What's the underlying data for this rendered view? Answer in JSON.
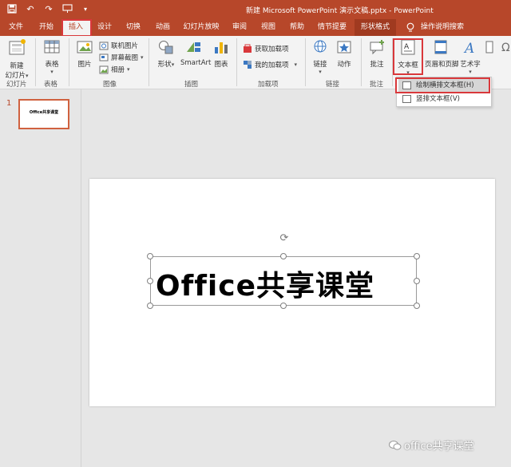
{
  "title_bar": {
    "document_title": "新建 Microsoft PowerPoint 演示文稿.pptx  -  PowerPoint",
    "qat": [
      "save-icon",
      "undo-icon",
      "redo-icon",
      "presenter-icon",
      "customize-icon"
    ]
  },
  "tabs": [
    "文件",
    "开始",
    "插入",
    "设计",
    "切换",
    "动画",
    "幻灯片放映",
    "审阅",
    "视图",
    "帮助",
    "情节提要",
    "形状格式",
    "操作说明搜索"
  ],
  "active_tab": "插入",
  "ribbon": {
    "slides": {
      "new_slide": "新建",
      "new_slide2": "幻灯片",
      "group": "幻灯片"
    },
    "tables": {
      "table": "表格",
      "group": "表格"
    },
    "images": {
      "picture": "图片",
      "online_picture": "联机图片",
      "screenshot": "屏幕截图",
      "album": "相册",
      "group": "图像"
    },
    "illustrations": {
      "shapes": "形状",
      "smartart": "SmartArt",
      "chart": "图表",
      "group": "插图"
    },
    "addins": {
      "get_addins": "获取加载项",
      "my_addins": "我的加载项",
      "group": "加载项"
    },
    "links": {
      "link": "链接",
      "action": "动作",
      "group": "链接"
    },
    "comments": {
      "comment": "批注",
      "group": "批注"
    },
    "text": {
      "textbox": "文本框",
      "header_footer": "页眉和页脚",
      "wordart": "艺术字"
    }
  },
  "textbox_menu": {
    "horizontal": "绘制横排文本框(H)",
    "vertical": "竖排文本框(V)"
  },
  "thumbnail": {
    "number": "1",
    "text": "Office共享课堂"
  },
  "slide": {
    "text": "Office共享课堂"
  },
  "watermark": "office共享课堂",
  "colors": {
    "accent": "#b7472a",
    "highlight_box": "#d9383b"
  }
}
